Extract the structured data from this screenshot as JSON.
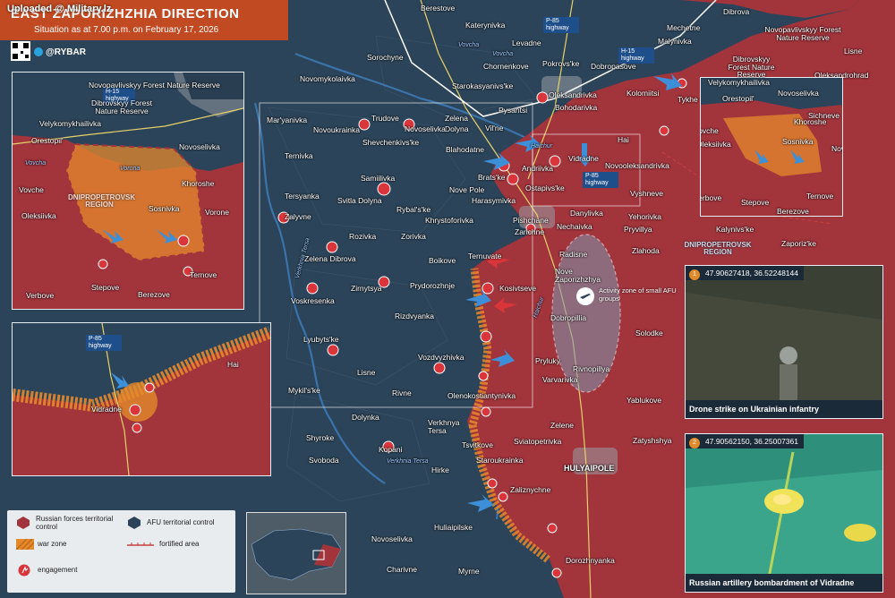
{
  "watermark": "Uploaded @ Military.lz",
  "header": {
    "title": "EAST ZAPORIZHZHIA DIRECTION",
    "subtitle": "Situation as at 7.00 p.m. on February 17, 2026",
    "brand": "@RYBAR"
  },
  "colors": {
    "russian": "#a2343c",
    "afu": "#2e4a62",
    "war_zone": "#e58a2c",
    "header": "#c24a22",
    "engagement": "#d9353b"
  },
  "legend": {
    "russian": "Russian forces territorial control",
    "afu": "AFU territorial control",
    "war_zone": "war zone",
    "fortified": "fortified area",
    "engagement": "engagement"
  },
  "highways": {
    "p85_top": "P-85 highway",
    "h15_top": "H-15 highway",
    "p85_mid": "P-85 highway",
    "h15_inset": "H-15 highway",
    "p85_inset": "P-85 highway"
  },
  "regions": {
    "dnipro_main": "DNIPROPETROVSK REGION",
    "dnipro_inset": "DNIPROPETROVSK REGION"
  },
  "activity_zone": "Activity zone of small AFU groups",
  "rivers": {
    "vovcha": "Vovcha",
    "vovcha2": "Vovcha",
    "haichur": "Haichur",
    "haichur2": "Haichur",
    "verkhnia_tersa": "Verkhnia Tersa",
    "verkhnia_tersa2": "Verkhnia Tersa",
    "vovcha_inset": "Vovcha",
    "vorona_inset": "Vorona"
  },
  "towns": {
    "berestove": "Berestove",
    "katerynivka": "Katerynivka",
    "levadne": "Levadne",
    "sorochyne": "Sorochyne",
    "chornenkove": "Chornenkove",
    "pokrovske": "Pokrovs'ke",
    "dobropasove": "Dobropasove",
    "novomykolaivka": "Novomykolaivka",
    "starokasyanivske": "Starokasyanivs'ke",
    "oleksandrivka": "Oleksandrivka",
    "kolomiitsi": "Kolomiitsi",
    "pysantsi": "Pysantsi",
    "bohodarivka": "Bohodarivka",
    "maryanivka": "Mar'yanivka",
    "trudove": "Trudove",
    "zelena": "Zelena",
    "dolyna": "Dolyna",
    "vilne": "Vil'ne",
    "novoselivka_top": "Novoselivka",
    "novoukrainka": "Novoukrainka",
    "shevchenkivske": "Shevchenkivs'ke",
    "blahodatne": "Blahodatne",
    "hai": "Hai",
    "ternivka": "Ternivka",
    "vidradne": "Vidradne",
    "novooleksandrivka": "Novooleksandrivka",
    "samiilivka": "Samiilivka",
    "bratske": "Brats'ke",
    "andriivka": "Andriivka",
    "ostapivske": "Ostapivs'ke",
    "tersyanka": "Tersyanka",
    "svitla_dolyna": "Svitla Dolyna",
    "nove_pole": "Nove Pole",
    "harasymivka": "Harasymivka",
    "vyshneve": "Vyshneve",
    "rybalske": "Rybal's'ke",
    "khrystoforivka": "Khrystoforivka",
    "danylivka": "Danylivka",
    "yehorivka": "Yehorivka",
    "pishchane": "Pishchane",
    "zalyvne": "Zalyvne",
    "zarichne": "Zarichne",
    "nechaivka": "Nechaivka",
    "pryvillya": "Pryvillya",
    "rozivka": "Rozivka",
    "zorivka": "Zorivka",
    "kalynivske": "Kalynivs'ke",
    "zaporizke": "Zaporiz'ke",
    "zlahoda": "Zlahoda",
    "zelena_dibrova": "Zelena Dibrova",
    "boikove": "Boikove",
    "radisne": "Radisne",
    "ternuvate": "Ternuvate",
    "pryodorozhnie": "Prydorozhnje",
    "kosivtseve": "Kosivtseve",
    "nove_zaporizhzhya": "Nove Zaporizhzhya",
    "zirnytsya": "Zirnytsya",
    "voskresenka": "Voskresenka",
    "rizdvyanka": "Rizdvyanka",
    "dobropillia": "Dobropillia",
    "lyubytske": "Lyubyts'ke",
    "solodke": "Solodke",
    "vozdvyzhivka": "Vozdvyzhivka",
    "pryluky": "Pryluky",
    "rivnopillya": "Rivnopillya",
    "lisne": "Lisne",
    "varvarivka": "Varvarivka",
    "mykilske": "Mykil's'ke",
    "rivne": "Rivne",
    "olenokostiantynivka": "Olenokostiantynivka",
    "yablukove": "Yablukove",
    "dolynka": "Dolynka",
    "verkhnia_tersa": "Verkhnya Tersa",
    "zelene": "Zelene",
    "shyroke": "Shyroke",
    "kopani": "Kopani",
    "tsvitkove": "Tsvitkove",
    "sviatopetrivka": "Sviatopetrivka",
    "zatyshshya": "Zatyshshya",
    "svoboda": "Svoboda",
    "hirke": "Hirke",
    "staroukrainka": "Staroukrainka",
    "hulyaipole": "HULYAIPOLE",
    "zaliznychne": "Zaliznychne",
    "huliaipilske": "Huliaipilske",
    "novoselivka_bot": "Novoselivka",
    "dorozhnyanka": "Dorozhnyanka",
    "charivne": "Charivne",
    "myrne": "Myrne",
    "dibrova": "Dibrova",
    "mechetne": "Mechetne",
    "malynivka": "Malynivka",
    "lisne_r": "Lisne",
    "oleksandrohrad": "Oleksandrohrad",
    "tykhe": "Tykhe",
    "velykomykhailivka": "Velykomykhailivka",
    "orestopil": "Orestopil'",
    "novoselivka_r": "Novoselivka",
    "khoroshe": "Khoroshe",
    "sichneve": "Sichneve",
    "vovche": "Vovche",
    "sosnivka": "Sosnivka",
    "oleksiivka": "Oleksiivka",
    "nove": "Nove",
    "ternove": "Ternove",
    "verbove": "Verbove",
    "stepove": "Stepove",
    "berezove": "Berezove"
  },
  "inset_tr": {
    "novopavlivskyy": "Novopavlivskyy Forest Nature Reserve",
    "dibrovskyy": "Dibrovskyy Forest Nature Reserve"
  },
  "inset_left": {
    "novopavlivskyy": "Novopavlivskyy Forest Nature Reserve",
    "dibrovskyy": "Dibrovskyy Forest Nature Reserve",
    "velykomykhailivka": "Velykomykhailivka",
    "orestopil": "Orestopil'",
    "novoselivka": "Novoselivka",
    "khoroshe": "Khoroshe",
    "vovche": "Vovche",
    "sosnivka": "Sosnivka",
    "vorone": "Vorone",
    "oleksiivka": "Oleksiivka",
    "ternove": "Ternove",
    "stepove": "Stepove",
    "berezove": "Berezove",
    "verbove": "Verbove"
  },
  "inset_vidradne": {
    "vidradne": "Vidradne",
    "hai": "Hai"
  },
  "photos": [
    {
      "num": "1",
      "coords": "47.90627418, 36.52248144",
      "caption": "Drone strike on Ukrainian infantry"
    },
    {
      "num": "2",
      "coords": "47.90562150, 36.25007361",
      "caption": "Russian artillery bombardment of Vidradne"
    }
  ]
}
